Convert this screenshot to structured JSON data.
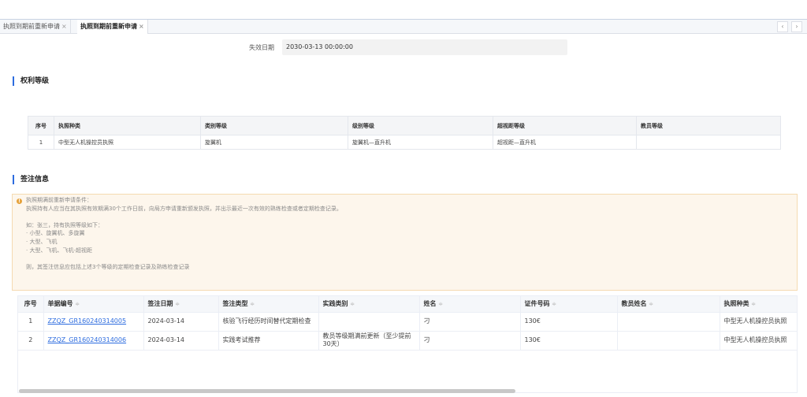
{
  "tabs": [
    {
      "label": "执照到期前重新申请",
      "close": "×"
    },
    {
      "label": "执照到期前重新申请",
      "close": "×"
    }
  ],
  "tab_nav": {
    "prev": "‹",
    "next": "›"
  },
  "expire": {
    "label": "失效日期",
    "value": "2030-03-13 00:00:00"
  },
  "rights_section": {
    "title": "权利等级",
    "columns": [
      "序号",
      "执照种类",
      "类别等级",
      "级别等级",
      "超视距等级",
      "教员等级"
    ],
    "rows": [
      [
        "1",
        "中型无人机操控员执照",
        "旋翼机",
        "旋翼机—直升机",
        "超视距—直升机",
        ""
      ]
    ]
  },
  "endorse_section": {
    "title": "签注信息",
    "notice": {
      "icon": "warning-icon",
      "lines": [
        "执照期满前重新申请条件：",
        "执照持有人应当在其执照有效期满30个工作日前，向局方申请重新颁发执照，并出示最近一次有效的熟练检查或者定期检查记录。",
        "",
        "如：张三，持有执照等级如下：",
        "· 小型、旋翼机、多旋翼",
        "· 大型、飞机",
        "· 大型、飞机、飞机-超视距",
        "",
        "则，其签注信息应包括上述3个等级的定期检查记录及熟练检查记录"
      ]
    },
    "sort_glyph": "≑",
    "columns": [
      "序号",
      "单据编号",
      "签注日期",
      "签注类型",
      "实践类别",
      "姓名",
      "证件号码",
      "教员姓名",
      "执照种类"
    ],
    "rows": [
      [
        "1",
        "ZZQZ_GR160240314005",
        "2024-03-14",
        "核验飞行经历时间替代定期检查",
        "",
        "刁",
        "130€",
        "",
        "中型无人机操控员执照"
      ],
      [
        "2",
        "ZZQZ_GR160240314006",
        "2024-03-14",
        "实践考试推荐",
        "教员等级期满前更新（至少提前30天）",
        "刁",
        "130€",
        "",
        "中型无人机操控员执照"
      ]
    ]
  }
}
